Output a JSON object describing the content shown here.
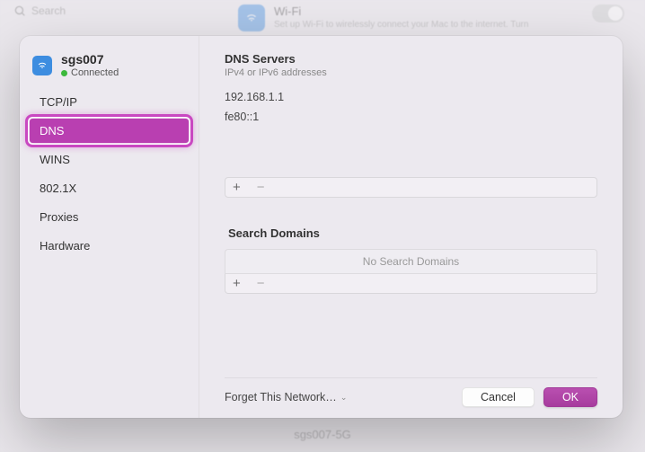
{
  "background": {
    "search_placeholder": "Search",
    "wifi_title": "Wi-Fi",
    "wifi_subtitle": "Set up Wi-Fi to wirelessly connect your Mac to the internet. Turn",
    "bottom_network": "sgs007-5G"
  },
  "network": {
    "name": "sgs007",
    "status": "Connected"
  },
  "tabs": [
    {
      "label": "TCP/IP"
    },
    {
      "label": "DNS"
    },
    {
      "label": "WINS"
    },
    {
      "label": "802.1X"
    },
    {
      "label": "Proxies"
    },
    {
      "label": "Hardware"
    }
  ],
  "dns": {
    "title": "DNS Servers",
    "subtitle": "IPv4 or IPv6 addresses",
    "servers": [
      "192.168.1.1",
      "fe80::1"
    ]
  },
  "search_domains": {
    "title": "Search Domains",
    "empty": "No Search Domains"
  },
  "footer": {
    "forget": "Forget This Network…",
    "cancel": "Cancel",
    "ok": "OK"
  }
}
